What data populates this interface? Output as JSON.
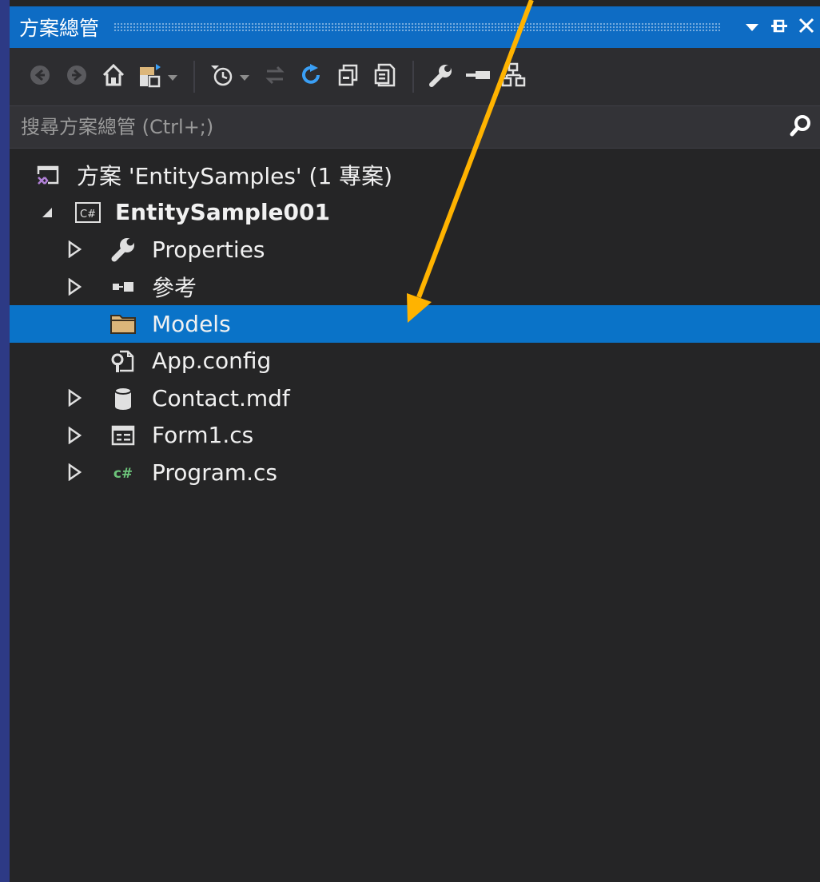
{
  "window": {
    "title": "方案總管",
    "controls": {
      "dropdown_icon": "triangle-down-icon",
      "pin_icon": "pin-icon",
      "close_icon": "close-icon"
    }
  },
  "toolbar": {
    "items": [
      "back-icon",
      "forward-icon",
      "home-icon",
      "switch-views-icon",
      "pending-changes-filter-icon",
      "sync-icon",
      "refresh-icon",
      "collapse-all-icon",
      "show-all-files-icon",
      "properties-icon",
      "preview-icon",
      "class-view-icon"
    ]
  },
  "search": {
    "placeholder": "搜尋方案總管 (Ctrl+;)",
    "value": ""
  },
  "tree": {
    "solution": {
      "label": "方案 'EntitySamples' (1 專案)",
      "icon": "visual-studio-solution-icon"
    },
    "project": {
      "label": "EntitySample001",
      "icon": "csharp-project-icon",
      "expanded": true
    },
    "items": [
      {
        "label": "Properties",
        "icon": "wrench-icon",
        "expandable": true
      },
      {
        "label": "參考",
        "icon": "references-icon",
        "expandable": true
      },
      {
        "label": "Models",
        "icon": "folder-icon",
        "expandable": false,
        "selected": true
      },
      {
        "label": "App.config",
        "icon": "config-file-icon",
        "expandable": false
      },
      {
        "label": "Contact.mdf",
        "icon": "database-icon",
        "expandable": true
      },
      {
        "label": "Form1.cs",
        "icon": "windows-form-icon",
        "expandable": true
      },
      {
        "label": "Program.cs",
        "icon": "csharp-file-icon",
        "expandable": true
      }
    ]
  },
  "annotation": {
    "color": "#ffb300",
    "points_to": "Models"
  },
  "colors": {
    "titlebar": "#0e6cc4",
    "selection": "#0a73c8",
    "background": "#252526",
    "accent_blue": "#3a9ff5"
  }
}
